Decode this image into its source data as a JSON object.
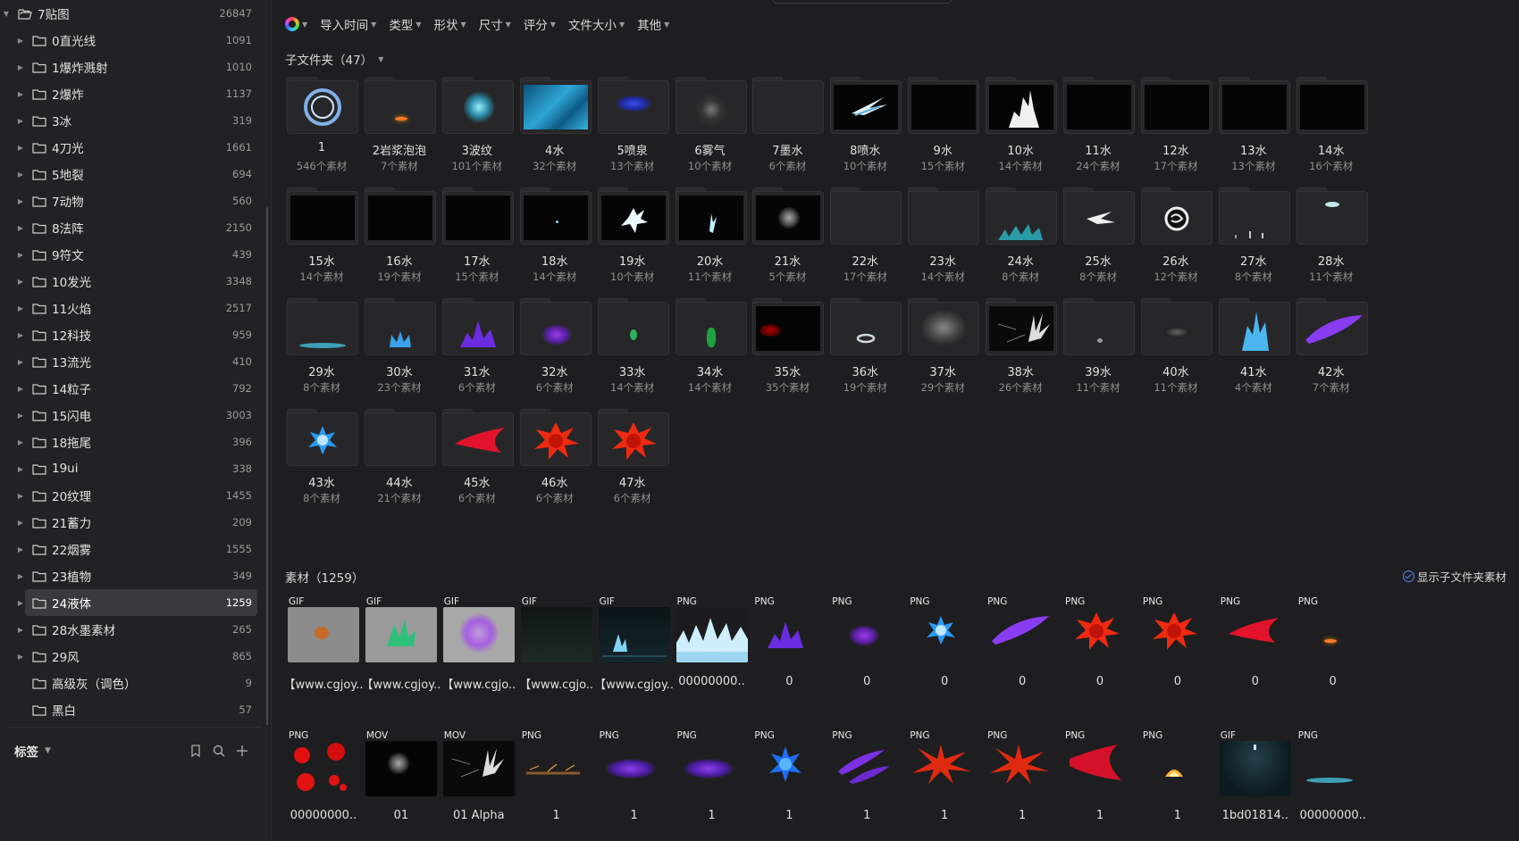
{
  "sidebar": {
    "root": {
      "label": "7贴图",
      "count": "26847"
    },
    "items": [
      {
        "label": "0直光线",
        "count": "1091"
      },
      {
        "label": "1爆炸溅射",
        "count": "1010"
      },
      {
        "label": "2爆炸",
        "count": "1137"
      },
      {
        "label": "3冰",
        "count": "319"
      },
      {
        "label": "4刀光",
        "count": "1661"
      },
      {
        "label": "5地裂",
        "count": "694"
      },
      {
        "label": "7动物",
        "count": "560"
      },
      {
        "label": "8法阵",
        "count": "2150"
      },
      {
        "label": "9符文",
        "count": "439"
      },
      {
        "label": "10发光",
        "count": "3348"
      },
      {
        "label": "11火焰",
        "count": "2517"
      },
      {
        "label": "12科技",
        "count": "959"
      },
      {
        "label": "13流光",
        "count": "410"
      },
      {
        "label": "14粒子",
        "count": "792"
      },
      {
        "label": "15闪电",
        "count": "3003"
      },
      {
        "label": "18拖尾",
        "count": "396"
      },
      {
        "label": "19ui",
        "count": "338"
      },
      {
        "label": "20纹理",
        "count": "1455"
      },
      {
        "label": "21蓄力",
        "count": "209"
      },
      {
        "label": "22烟雾",
        "count": "1555"
      },
      {
        "label": "23植物",
        "count": "349"
      },
      {
        "label": "24液体",
        "count": "1259",
        "selected": true
      },
      {
        "label": "28水墨素材",
        "count": "265"
      },
      {
        "label": "29风",
        "count": "865"
      },
      {
        "label": "高级灰（调色）",
        "count": "9"
      },
      {
        "label": "黑白",
        "count": "57"
      }
    ],
    "tags": {
      "title": "标签",
      "icons": [
        "bookmark-icon",
        "search-icon",
        "plus-icon"
      ]
    }
  },
  "filters": {
    "color_icon": "color-wheel-icon",
    "items": [
      "导入时间",
      "类型",
      "形状",
      "尺寸",
      "评分",
      "文件大小",
      "其他"
    ]
  },
  "subfolders": {
    "title": "子文件夹（47）",
    "items": [
      {
        "name": "1",
        "count": "546个素材",
        "thumb": "swirl"
      },
      {
        "name": "2岩浆泡泡",
        "count": "7个素材",
        "thumb": "ember"
      },
      {
        "name": "3波纹",
        "count": "101个素材",
        "thumb": "teal-burst"
      },
      {
        "name": "4水",
        "count": "32个素材",
        "thumb": "water"
      },
      {
        "name": "5喷泉",
        "count": "13个素材",
        "thumb": "blue-splash"
      },
      {
        "name": "6雾气",
        "count": "10个素材",
        "thumb": "mist"
      },
      {
        "name": "7墨水",
        "count": "6个素材",
        "thumb": "empty"
      },
      {
        "name": "8喷水",
        "count": "10个素材",
        "thumb": "black-jet"
      },
      {
        "name": "9水",
        "count": "15个素材",
        "thumb": "black"
      },
      {
        "name": "10水",
        "count": "14个素材",
        "thumb": "black-white"
      },
      {
        "name": "11水",
        "count": "24个素材",
        "thumb": "black"
      },
      {
        "name": "12水",
        "count": "17个素材",
        "thumb": "black"
      },
      {
        "name": "13水",
        "count": "13个素材",
        "thumb": "black"
      },
      {
        "name": "14水",
        "count": "16个素材",
        "thumb": "black"
      },
      {
        "name": "15水",
        "count": "14个素材",
        "thumb": "black"
      },
      {
        "name": "16水",
        "count": "19个素材",
        "thumb": "black"
      },
      {
        "name": "17水",
        "count": "15个素材",
        "thumb": "black"
      },
      {
        "name": "18水",
        "count": "14个素材",
        "thumb": "black-dot"
      },
      {
        "name": "19水",
        "count": "10个素材",
        "thumb": "black-splash"
      },
      {
        "name": "20水",
        "count": "11个素材",
        "thumb": "black-splash-small"
      },
      {
        "name": "21水",
        "count": "5个素材",
        "thumb": "black-smoke"
      },
      {
        "name": "22水",
        "count": "17个素材",
        "thumb": "empty"
      },
      {
        "name": "23水",
        "count": "14个素材",
        "thumb": "empty"
      },
      {
        "name": "24水",
        "count": "8个素材",
        "thumb": "teal-crown"
      },
      {
        "name": "25水",
        "count": "8个素材",
        "thumb": "white-streak"
      },
      {
        "name": "26水",
        "count": "12个素材",
        "thumb": "white-swirl"
      },
      {
        "name": "27水",
        "count": "8个素材",
        "thumb": "drops"
      },
      {
        "name": "28水",
        "count": "11个素材",
        "thumb": "fish"
      },
      {
        "name": "29水",
        "count": "8个素材",
        "thumb": "teal-pool"
      },
      {
        "name": "30水",
        "count": "23个素材",
        "thumb": "blue-crown"
      },
      {
        "name": "31水",
        "count": "6个素材",
        "thumb": "purple-burst"
      },
      {
        "name": "32水",
        "count": "6个素材",
        "thumb": "purple-swirl"
      },
      {
        "name": "33水",
        "count": "14个素材",
        "thumb": "green-drop"
      },
      {
        "name": "34水",
        "count": "14个素材",
        "thumb": "green-figure"
      },
      {
        "name": "35水",
        "count": "35个素材",
        "thumb": "dark-red"
      },
      {
        "name": "36水",
        "count": "19个素材",
        "thumb": "ring"
      },
      {
        "name": "37水",
        "count": "29个素材",
        "thumb": "gray-wave"
      },
      {
        "name": "38水",
        "count": "26个素材",
        "thumb": "black-spray"
      },
      {
        "name": "39水",
        "count": "11个素材",
        "thumb": "small-drop"
      },
      {
        "name": "40水",
        "count": "11个素材",
        "thumb": "dark-splash"
      },
      {
        "name": "41水",
        "count": "4个素材",
        "thumb": "blue-flame"
      },
      {
        "name": "42水",
        "count": "7个素材",
        "thumb": "violet-streak"
      },
      {
        "name": "43水",
        "count": "8个素材",
        "thumb": "blue-star"
      },
      {
        "name": "44水",
        "count": "21个素材",
        "thumb": "empty"
      },
      {
        "name": "45水",
        "count": "6个素材",
        "thumb": "red-wisp"
      },
      {
        "name": "46水",
        "count": "6个素材",
        "thumb": "red-splat"
      },
      {
        "name": "47水",
        "count": "6个素材",
        "thumb": "red-splat"
      }
    ]
  },
  "assets": {
    "title": "素材（1259）",
    "show_subfolder_label": "显示子文件夹素材",
    "items": [
      {
        "type": "GIF",
        "name": "【www.cgjoy..",
        "thumb": "gray-orange"
      },
      {
        "type": "GIF",
        "name": "【www.cgjoy..",
        "thumb": "gray-green"
      },
      {
        "type": "GIF",
        "name": "【www.cgjo..",
        "thumb": "gray-ring"
      },
      {
        "type": "GIF",
        "name": "【www.cgjo..",
        "thumb": "dark-green"
      },
      {
        "type": "GIF",
        "name": "【www.cgjoy..",
        "thumb": "dark-ui"
      },
      {
        "type": "PNG",
        "name": "00000000..",
        "thumb": "ice-wave"
      },
      {
        "type": "PNG",
        "name": "0",
        "thumb": "purple-burst"
      },
      {
        "type": "PNG",
        "name": "0",
        "thumb": "purple-swirl"
      },
      {
        "type": "PNG",
        "name": "0",
        "thumb": "blue-star"
      },
      {
        "type": "PNG",
        "name": "0",
        "thumb": "violet-streak"
      },
      {
        "type": "PNG",
        "name": "0",
        "thumb": "red-splat"
      },
      {
        "type": "PNG",
        "name": "0",
        "thumb": "red-splat"
      },
      {
        "type": "PNG",
        "name": "0",
        "thumb": "red-wisp"
      },
      {
        "type": "PNG",
        "name": "0",
        "thumb": "ember"
      },
      {
        "type": "PNG",
        "name": "00000000..",
        "thumb": "red-blobs"
      },
      {
        "type": "MOV",
        "name": "01",
        "thumb": "black-smoke"
      },
      {
        "type": "MOV",
        "name": "01 Alpha",
        "thumb": "black-spray"
      },
      {
        "type": "PNG",
        "name": "1",
        "thumb": "sparks"
      },
      {
        "type": "PNG",
        "name": "1",
        "thumb": "purple-pool"
      },
      {
        "type": "PNG",
        "name": "1",
        "thumb": "purple-pool"
      },
      {
        "type": "PNG",
        "name": "1",
        "thumb": "blue-star2"
      },
      {
        "type": "PNG",
        "name": "1",
        "thumb": "violet-streaks"
      },
      {
        "type": "PNG",
        "name": "1",
        "thumb": "red-spike"
      },
      {
        "type": "PNG",
        "name": "1",
        "thumb": "red-spike"
      },
      {
        "type": "PNG",
        "name": "1",
        "thumb": "red-wisp2"
      },
      {
        "type": "PNG",
        "name": "1",
        "thumb": "orange-dome"
      },
      {
        "type": "GIF",
        "name": "1bd01814..",
        "thumb": "teal-dark"
      },
      {
        "type": "PNG",
        "name": "00000000..",
        "thumb": "teal-pool"
      }
    ]
  }
}
